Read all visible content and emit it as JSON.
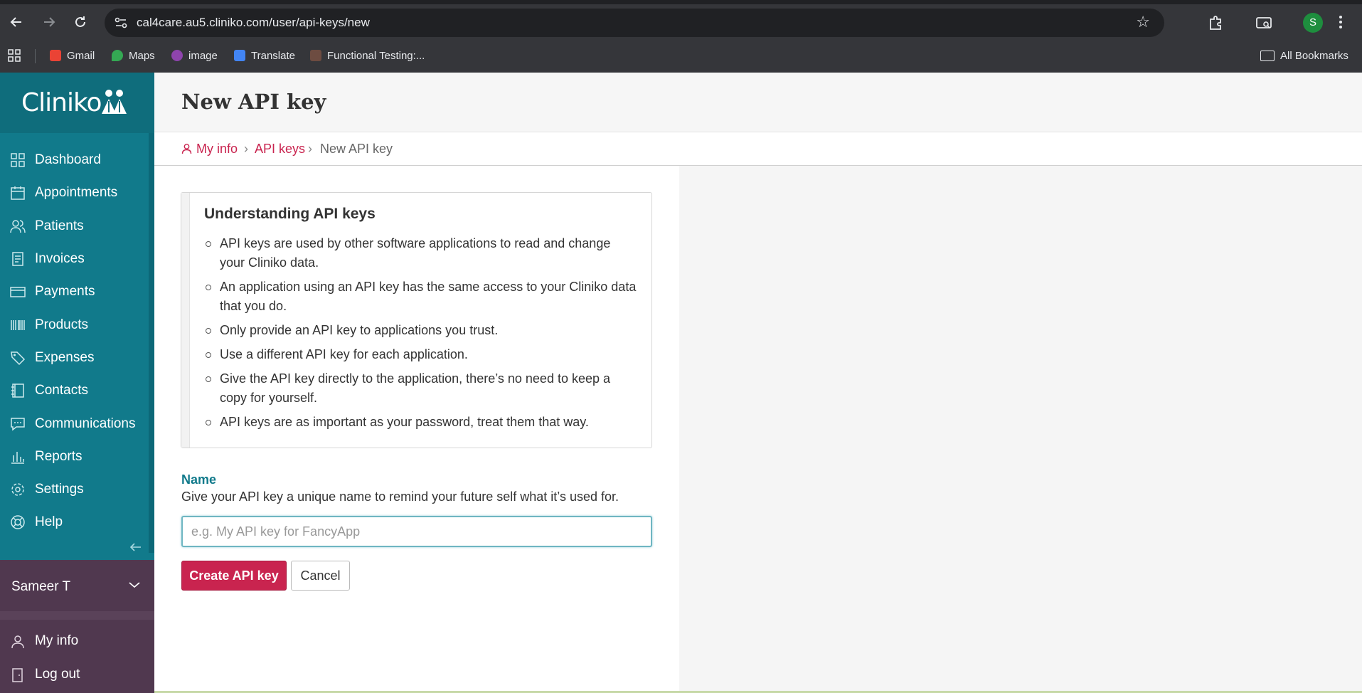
{
  "browser": {
    "url": "cal4care.au5.cliniko.com/user/api-keys/new",
    "profile_initial": "S",
    "bookmarks": [
      {
        "label": "Gmail",
        "icon": "gmail-icon",
        "color": "#ea4335"
      },
      {
        "label": "Maps",
        "icon": "maps-icon",
        "color": "#34a853"
      },
      {
        "label": "image",
        "icon": "image-icon",
        "color": "#8e44ad"
      },
      {
        "label": "Translate",
        "icon": "translate-icon",
        "color": "#4285f4"
      },
      {
        "label": "Functional Testing:...",
        "icon": "functional-testing-icon",
        "color": "#6d4c41"
      }
    ],
    "all_bookmarks_label": "All Bookmarks"
  },
  "app": {
    "logo_text": "Cliniko",
    "nav": [
      {
        "label": "Dashboard",
        "icon": "dashboard-icon"
      },
      {
        "label": "Appointments",
        "icon": "calendar-icon"
      },
      {
        "label": "Patients",
        "icon": "patients-icon"
      },
      {
        "label": "Invoices",
        "icon": "invoice-icon"
      },
      {
        "label": "Payments",
        "icon": "card-icon"
      },
      {
        "label": "Products",
        "icon": "barcode-icon"
      },
      {
        "label": "Expenses",
        "icon": "tag-icon"
      },
      {
        "label": "Contacts",
        "icon": "contacts-icon"
      },
      {
        "label": "Communications",
        "icon": "chat-icon"
      },
      {
        "label": "Reports",
        "icon": "chart-icon"
      },
      {
        "label": "Settings",
        "icon": "gear-icon"
      },
      {
        "label": "Help",
        "icon": "help-icon"
      }
    ],
    "user": {
      "name": "Sameer T",
      "links": [
        {
          "label": "My info",
          "icon": "user-icon"
        },
        {
          "label": "Log out",
          "icon": "logout-icon"
        }
      ]
    },
    "colors": {
      "sidebar": "#117a8b",
      "accent": "#c9244f",
      "user_panel": "#50384f"
    }
  },
  "page": {
    "title": "New API key",
    "breadcrumb": {
      "my_info": "My info",
      "sep": "›",
      "api_keys": "API keys",
      "current": "New API key"
    },
    "info": {
      "title": "Understanding API keys",
      "items": [
        "API keys are used by other software applications to read and change your Cliniko data.",
        "An application using an API key has the same access to your Cliniko data that you do.",
        "Only provide an API key to applications you trust.",
        "Use a different API key for each application.",
        "Give the API key directly to the application, there’s no need to keep a copy for yourself.",
        "API keys are as important as your password, treat them that way."
      ]
    },
    "form": {
      "name_label": "Name",
      "name_help": "Give your API key a unique name to remind your future self what it’s used for.",
      "name_value": "",
      "name_placeholder": "e.g. My API key for FancyApp",
      "submit_label": "Create API key",
      "cancel_label": "Cancel"
    }
  }
}
